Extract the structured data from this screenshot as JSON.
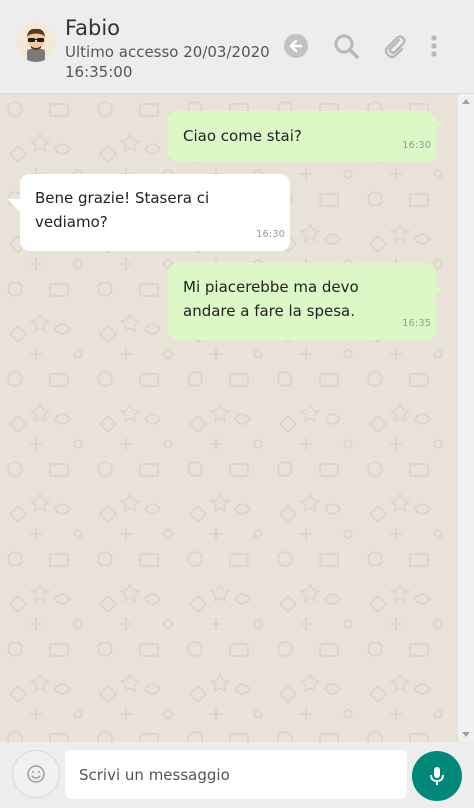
{
  "header": {
    "contact_name": "Fabio",
    "last_seen": "Ultimo accesso 20/03/2020 16:35:00",
    "icons": [
      "avatar",
      "back-arrow-icon",
      "search-icon",
      "paperclip-icon",
      "more-vert-icon"
    ]
  },
  "messages": [
    {
      "direction": "out",
      "text": "Ciao come stai?",
      "time": "16:30"
    },
    {
      "direction": "in",
      "text": "Bene grazie! Stasera ci vediamo?",
      "time": "16:30"
    },
    {
      "direction": "out",
      "text": "Mi piacerebbe ma devo andare a fare la spesa.",
      "time": "16:35"
    }
  ],
  "composer": {
    "placeholder": "Scrivi un messaggio",
    "icons": [
      "emoji-icon",
      "microphone-icon"
    ]
  },
  "colors": {
    "outgoing_bubble": "#dcf8c6",
    "incoming_bubble": "#ffffff",
    "mic_button": "#00897b",
    "chat_background": "#e8e2d9"
  }
}
